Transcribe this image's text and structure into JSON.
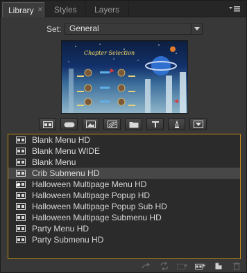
{
  "tabs": [
    {
      "label": "Library",
      "active": true,
      "close": "✕"
    },
    {
      "label": "Styles",
      "active": false
    },
    {
      "label": "Layers",
      "active": false
    }
  ],
  "set": {
    "label": "Set:",
    "value": "General"
  },
  "preview": {
    "title": "Chapter Selection"
  },
  "tools": [
    "menu-icon",
    "button-icon",
    "image-icon",
    "background-icon",
    "folder-icon",
    "text-icon",
    "audio-icon",
    "transition-icon"
  ],
  "items": [
    {
      "label": "Blank Menu HD",
      "selected": false
    },
    {
      "label": "Blank Menu WIDE",
      "selected": false
    },
    {
      "label": "Blank Menu",
      "selected": false
    },
    {
      "label": "Crib Submenu HD",
      "selected": true
    },
    {
      "label": "Halloween Multipage Menu HD",
      "selected": false
    },
    {
      "label": "Halloween Multipage Popup HD",
      "selected": false
    },
    {
      "label": "Halloween Multipage Popup Sub HD",
      "selected": false
    },
    {
      "label": "Halloween Multipage Submenu HD",
      "selected": false
    },
    {
      "label": "Party Menu HD",
      "selected": false
    },
    {
      "label": "Party Submenu HD",
      "selected": false
    }
  ],
  "colors": {
    "accent": "#c08a14",
    "selected_row": "#474747",
    "panel": "#383838"
  }
}
